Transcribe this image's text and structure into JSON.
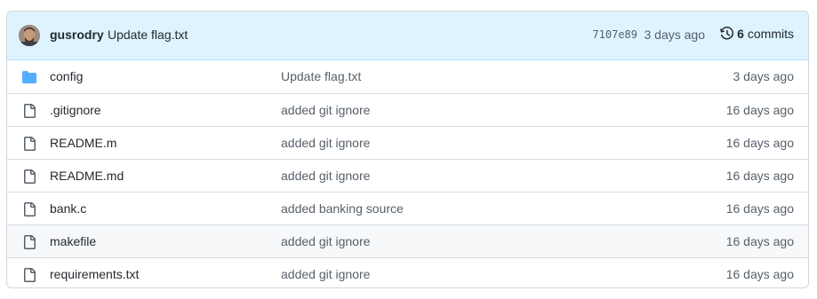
{
  "latest_commit": {
    "author": "gusrodry",
    "message": "Update flag.txt",
    "sha": "7107e89",
    "age": "3 days ago",
    "commit_count": "6",
    "commits_label": "commits"
  },
  "files": [
    {
      "name": "config",
      "type": "folder",
      "message": "Update flag.txt",
      "age": "3 days ago"
    },
    {
      "name": ".gitignore",
      "type": "file",
      "message": "added git ignore",
      "age": "16 days ago"
    },
    {
      "name": "README.m",
      "type": "file",
      "message": "added git ignore",
      "age": "16 days ago"
    },
    {
      "name": "README.md",
      "type": "file",
      "message": "added git ignore",
      "age": "16 days ago"
    },
    {
      "name": "bank.c",
      "type": "file",
      "message": "added banking source",
      "age": "16 days ago"
    },
    {
      "name": "makefile",
      "type": "file",
      "message": "added git ignore",
      "age": "16 days ago"
    },
    {
      "name": "requirements.txt",
      "type": "file",
      "message": "added git ignore",
      "age": "16 days ago"
    }
  ],
  "colors": {
    "folder": "#54aeff",
    "file": "#57606a",
    "header_bg": "#ddf4ff"
  }
}
